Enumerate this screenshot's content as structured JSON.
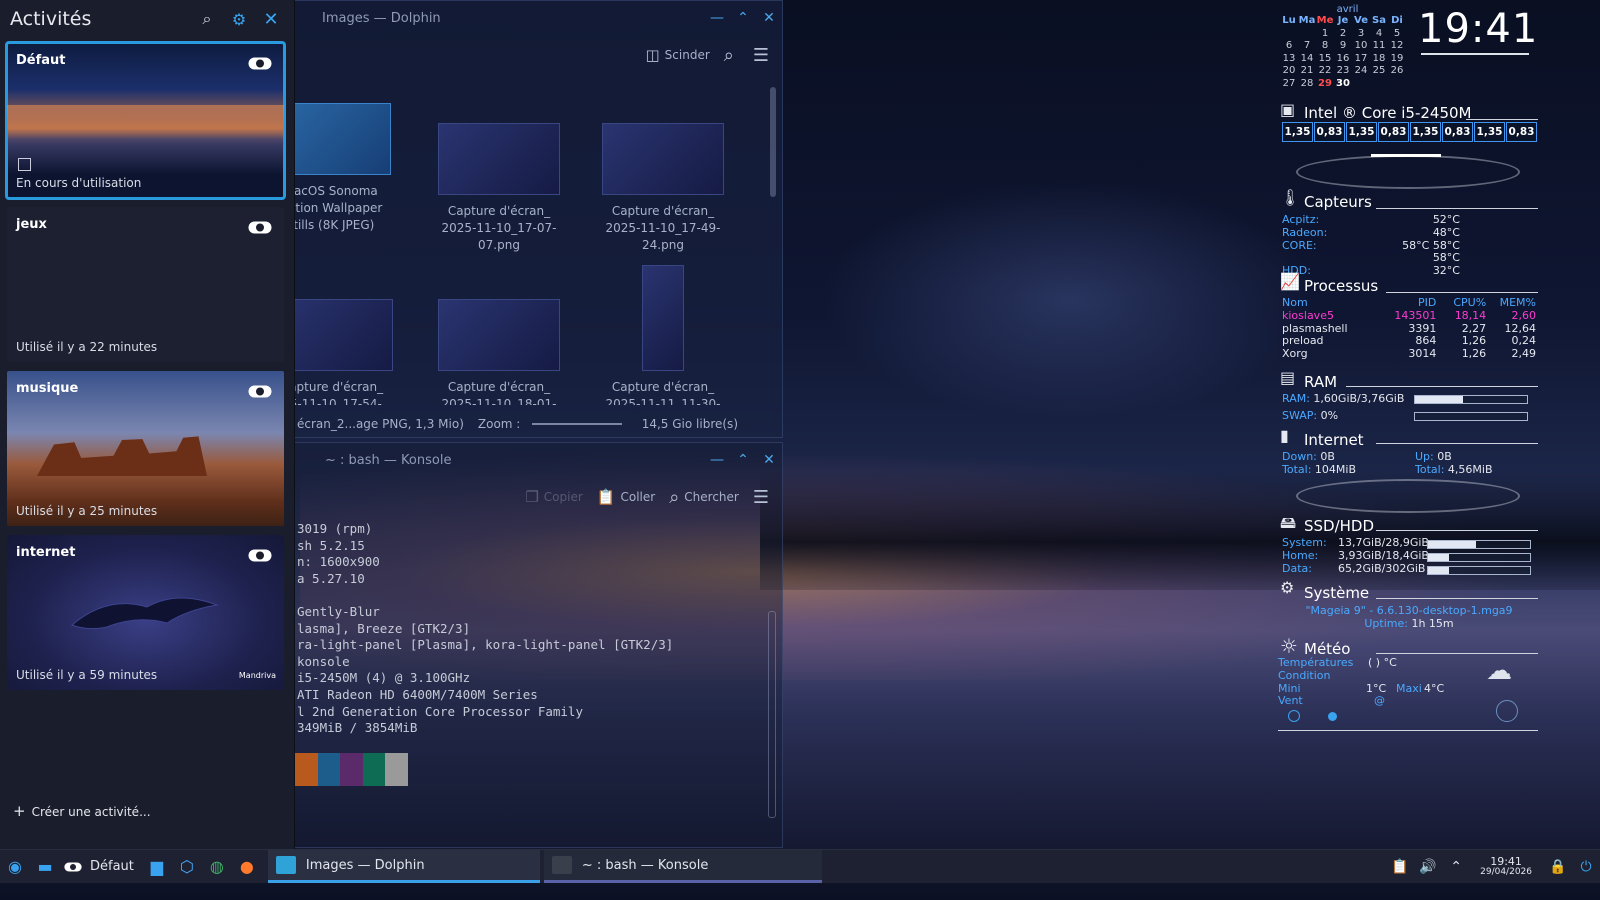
{
  "activities": {
    "title": "Activités",
    "create_label": "Créer une activité...",
    "items": [
      {
        "name": "Défaut",
        "status": "En cours d'utilisation"
      },
      {
        "name": "jeux",
        "status": "Utilisé il y a 22 minutes"
      },
      {
        "name": "musique",
        "status": "Utilisé il y a 25 minutes"
      },
      {
        "name": "internet",
        "status": "Utilisé il y a 59 minutes"
      }
    ],
    "mandriva_logo": "Mandriva"
  },
  "dolphin": {
    "title": "Images — Dolphin",
    "split_label": "Scinder",
    "files": [
      {
        "name1": "macOS Sonoma",
        "name2": "Motion Wallpaper",
        "name3": "Stills (8K JPEG)"
      },
      {
        "name1": "Capture d'écran_",
        "name2": "2025-11-10_17-07-",
        "name3": "07.png"
      },
      {
        "name1": "Capture d'écran_",
        "name2": "2025-11-10_17-49-",
        "name3": "24.png"
      },
      {
        "name1": "Capture d'écran_",
        "name2": "25-11-10_17-54-",
        "name3": ""
      },
      {
        "name1": "Capture d'écran_",
        "name2": "2025-11-10_18-01-",
        "name3": ""
      },
      {
        "name1": "Capture d'écran_",
        "name2": "2025-11-11_11-30-",
        "name3": ""
      }
    ],
    "status_file": "écran_2...age PNG, 1,3 Mio)",
    "zoom_label": "Zoom :",
    "free_space": "14,5 Gio libre(s)"
  },
  "konsole": {
    "title": "~ : bash — Konsole",
    "copy_label": "Copier",
    "paste_label": "Coller",
    "find_label": "Chercher",
    "lines": [
      "3019 (rpm)",
      "sh 5.2.15",
      "n: 1600x900",
      "a 5.27.10",
      "",
      "Gently-Blur",
      "lasma], Breeze [GTK2/3]",
      "ra-light-panel [Plasma], kora-light-panel [GTK2/3]",
      "konsole",
      "i5-2450M (4) @ 3.100GHz",
      "ATI Radeon HD 6400M/7400M Series",
      "l 2nd Generation Core Processor Family",
      "349MiB / 3854MiB"
    ],
    "swatch_colors": [
      "#b8591e",
      "#1d5d8c",
      "#5a2a6a",
      "#0e6b54",
      "#9a9a9a"
    ]
  },
  "conky": {
    "calendar": {
      "month": "avril",
      "days": [
        "Lu",
        "Ma",
        "Me",
        "Je",
        "Ve",
        "Sa",
        "Di"
      ],
      "current_day_index": 2,
      "weeks": [
        [
          "",
          "",
          "1",
          "2",
          "3",
          "4",
          "5"
        ],
        [
          "6",
          "7",
          "8",
          "9",
          "10",
          "11",
          "12"
        ],
        [
          "13",
          "14",
          "15",
          "16",
          "17",
          "18",
          "19"
        ],
        [
          "20",
          "21",
          "22",
          "23",
          "24",
          "25",
          "26"
        ],
        [
          "27",
          "28",
          "29",
          "30",
          "",
          "",
          ""
        ]
      ],
      "today": "29",
      "selected": "30"
    },
    "clock": "19:41",
    "cpu": {
      "title": "Intel ® Core i5-2450M",
      "cores": [
        "1,35",
        "0,83",
        "1,35",
        "0,83",
        "1,35",
        "0,83",
        "1,35",
        "0,83"
      ]
    },
    "sensors": {
      "title": "Capteurs",
      "rows": [
        {
          "label": "Acpitz:",
          "value": "52°C"
        },
        {
          "label": "Radeon:",
          "value": "48°C"
        },
        {
          "label": "CORE:",
          "value": "58°C 58°C 58°C"
        },
        {
          "label": "HDD:",
          "value": "32°C"
        }
      ]
    },
    "processes": {
      "title": "Processus",
      "headers": [
        "Nom",
        "PID",
        "CPU%",
        "MEM%"
      ],
      "rows": [
        [
          "kioslave5",
          "143501",
          "18,14",
          "2,60"
        ],
        [
          "plasmashell",
          "3391",
          "2,27",
          "12,64"
        ],
        [
          "preload",
          "864",
          "1,26",
          "0,24"
        ],
        [
          "Xorg",
          "3014",
          "1,26",
          "2,49"
        ]
      ]
    },
    "ram": {
      "title": "RAM",
      "ram_label": "RAM:",
      "ram_value": "1,60GiB/3,76GiB",
      "ram_fraction": 0.43,
      "swap_label": "SWAP:",
      "swap_value": "0%",
      "swap_fraction": 0.0
    },
    "internet": {
      "title": "Internet",
      "down_label": "Down:",
      "down_value": "0B",
      "up_label": "Up:",
      "up_value": "0B",
      "total_down_label": "Total:",
      "total_down_value": "104MiB",
      "total_up_label": "Total:",
      "total_up_value": "4,56MiB"
    },
    "disks": {
      "title": "SSD/HDD",
      "rows": [
        {
          "label": "System:",
          "value": "13,7GiB/28,9GiB",
          "fraction": 0.47
        },
        {
          "label": "Home:",
          "value": "3,93GiB/18,4GiB",
          "fraction": 0.21
        },
        {
          "label": "Data:",
          "value": "65,2GiB/302GiB",
          "fraction": 0.21
        }
      ]
    },
    "system": {
      "title": "Système",
      "distro": "\"Mageia 9\" - 6.6.130-desktop-1.mga9",
      "uptime_label": "Uptime:",
      "uptime_value": "1h 15m"
    },
    "weather": {
      "title": "Météo",
      "temp_label": "Températures",
      "temp_value": "( ) °C",
      "condition_label": "Condition",
      "min_label": "Mini",
      "min_value": "1°C",
      "max_label": "Maxi",
      "max_value": "4°C",
      "wind_label": "Vent",
      "wind_value": "@"
    }
  },
  "taskbar": {
    "activity_label": "Défaut",
    "tasks": [
      "Images — Dolphin",
      "~ : bash — Konsole"
    ],
    "time": "19:41",
    "date": "29/04/2026"
  },
  "colors": {
    "accent": "#3aa3ef",
    "conky_label": "#4aa9ff",
    "process_hot": "#ff3bd0"
  }
}
